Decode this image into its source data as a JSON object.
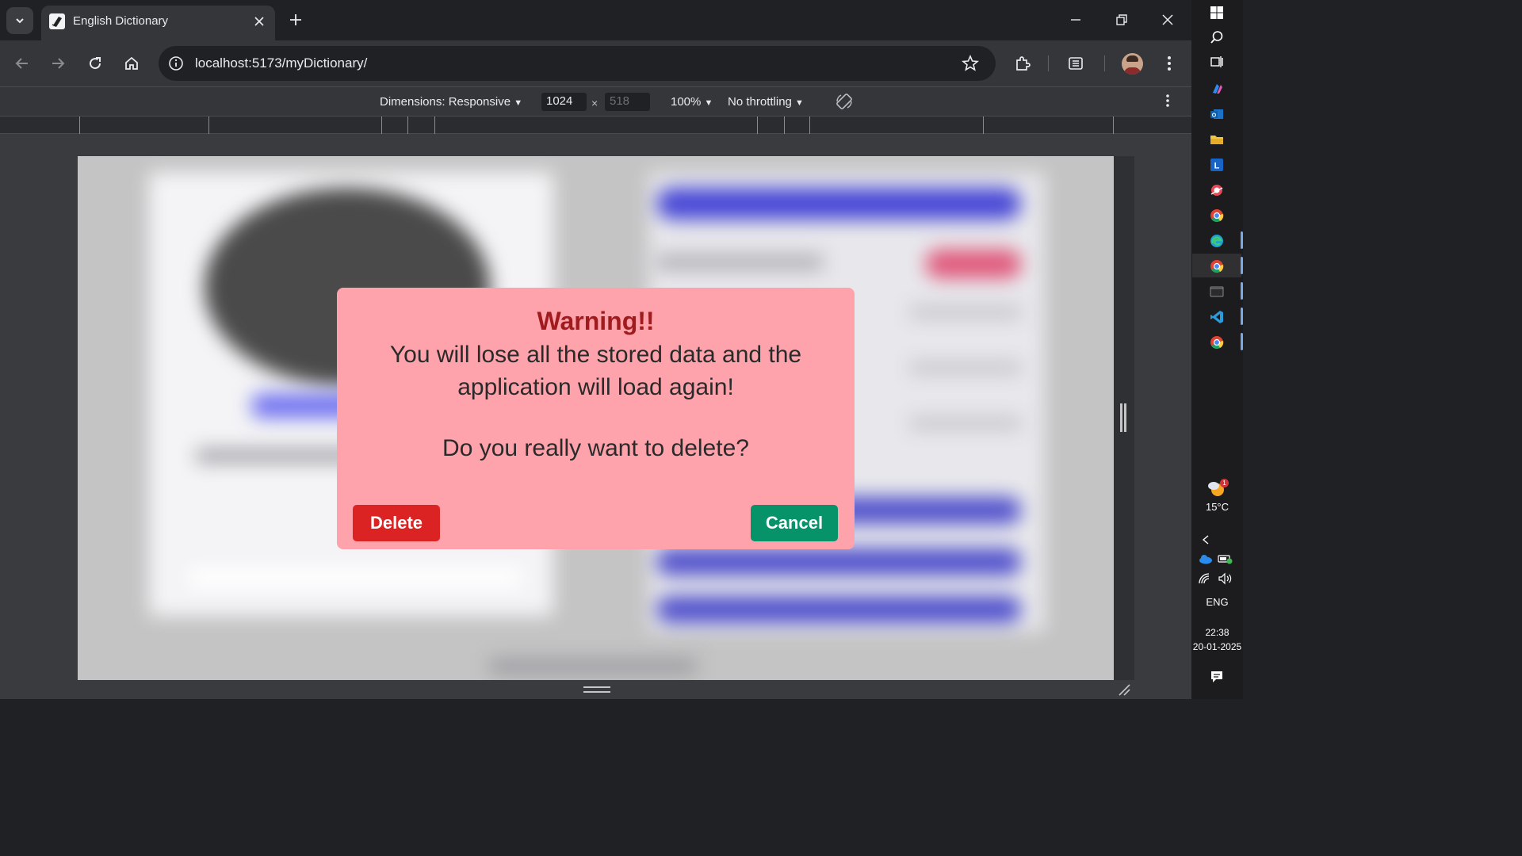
{
  "browser": {
    "tab_title": "English Dictionary",
    "url_host": "localhost",
    "url_rest": ":5173/myDictionary/"
  },
  "devtools": {
    "dimensions_label": "Dimensions: Responsive",
    "width_value": "1024",
    "times": "×",
    "height_placeholder": "518",
    "zoom": "100%",
    "throttling": "No throttling"
  },
  "modal": {
    "title": "Warning!!",
    "message": "You will lose all the stored data and the application will load again!",
    "question": "Do you really want to delete?",
    "delete_label": "Delete",
    "cancel_label": "Cancel",
    "bg_color": "#fea2ab",
    "delete_color": "#dc2323",
    "cancel_color": "#06936a"
  },
  "taskbar": {
    "weather_temp": "15°C",
    "weather_badge": "1",
    "language": "ENG",
    "time": "22:38",
    "date": "20-01-2025"
  }
}
